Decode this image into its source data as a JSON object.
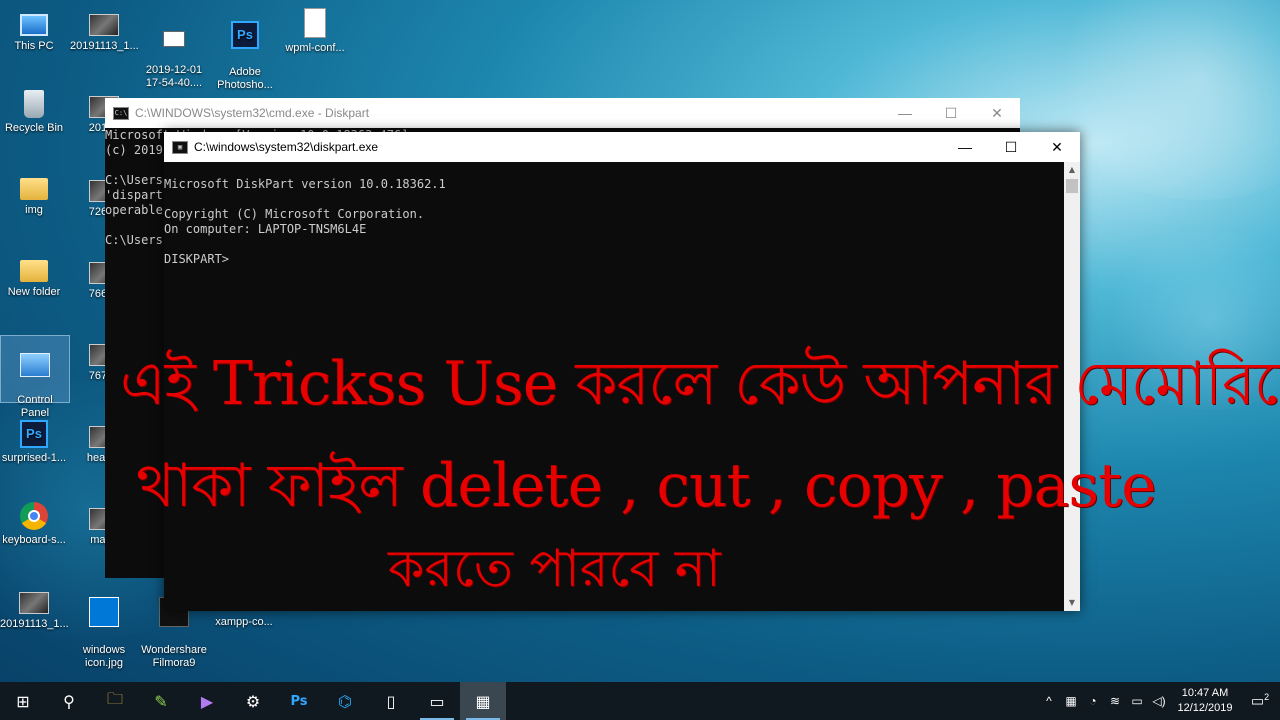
{
  "desktop": {
    "icons": [
      {
        "label": "This PC"
      },
      {
        "label": "20191113_1..."
      },
      {
        "label": "2019-12-01\n17-54-40...."
      },
      {
        "label": "Adobe\nPhotosho..."
      },
      {
        "label": "wpml-conf..."
      },
      {
        "label": "Recycle Bin"
      },
      {
        "label": "20191"
      },
      {
        "label": "img"
      },
      {
        "label": "72646"
      },
      {
        "label": "New folder"
      },
      {
        "label": "76640"
      },
      {
        "label": "Control\nPanel"
      },
      {
        "label": "76732"
      },
      {
        "label": "surprised-1..."
      },
      {
        "label": "header"
      },
      {
        "label": "keyboard-s..."
      },
      {
        "label": "map-i"
      },
      {
        "label": "20191113_1..."
      },
      {
        "label": "windows\nicon.jpg"
      },
      {
        "label": "Wondershare\nFilmora9"
      },
      {
        "label": "xampp-co..."
      }
    ]
  },
  "cmd_window": {
    "title": "C:\\WINDOWS\\system32\\cmd.exe - Diskpart",
    "console": "Microsoft Windows [Version 10.0.18363.476]\n(c) 2019 Microsoft Corporation. All rights reserved.\n\nC:\\Users\n'dispart\noperable\n\nC:\\Users"
  },
  "diskpart_window": {
    "title": "C:\\windows\\system32\\diskpart.exe",
    "console": "\nMicrosoft DiskPart version 10.0.18362.1\n\nCopyright (C) Microsoft Corporation.\nOn computer: LAPTOP-TNSM6L4E\n\nDISKPART>"
  },
  "window_buttons": {
    "minimize": "—",
    "maximize": "☐",
    "close": "✕"
  },
  "overlay": {
    "line1": "এই Trickss Use করলে কেউ আপনার মেমোরিতে",
    "line2": "থাকা ফাইল delete , cut , copy , paste",
    "line3": "করতে পারবে না",
    "color": "#e60000"
  },
  "taskbar": {
    "start": "⊞",
    "search": "⚲",
    "apps": [
      "File Explorer",
      "Notepad++",
      "Visual Studio",
      "Settings",
      "Photoshop",
      "VS Code",
      "Notepad",
      "Command Prompt",
      "Control Panel"
    ],
    "app_glyphs": [
      "🗀",
      "✎",
      "▶",
      "⚙",
      "Ps",
      "⌬",
      "▯",
      "▭",
      "▦"
    ],
    "tray": {
      "chevron": "^",
      "time": "10:47 AM",
      "date": "12/12/2019",
      "notification_count": "2"
    }
  }
}
